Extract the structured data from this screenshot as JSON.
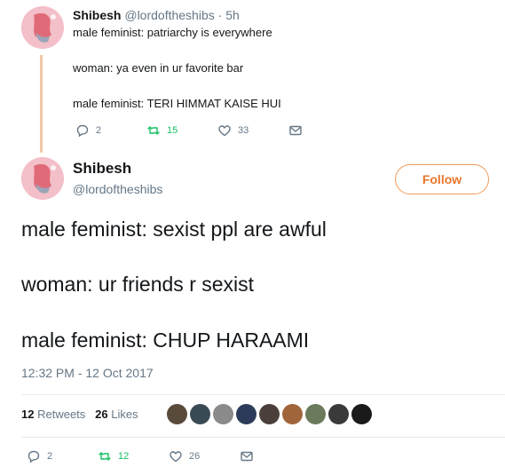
{
  "reply_tweet": {
    "name": "Shibesh",
    "handle": "@lordoftheshibs",
    "separator": "·",
    "time": "5h",
    "lines": [
      "male feminist: patriarchy is everywhere",
      "woman: ya even in ur favorite bar",
      "male feminist: TERI HIMMAT KAISE HUI"
    ],
    "replies": "2",
    "retweets": "15",
    "likes": "33"
  },
  "main_tweet": {
    "name": "Shibesh",
    "handle": "@lordoftheshibs",
    "follow_label": "Follow",
    "lines": [
      "male feminist: sexist ppl are awful",
      "woman: ur friends r sexist",
      "male feminist: CHUP HARAAMI"
    ],
    "timestamp": "12:32 PM - 12 Oct 2017",
    "retweet_count": "12",
    "retweets_label": "Retweets",
    "like_count": "26",
    "likes_label": "Likes",
    "replies": "2",
    "retweets": "12",
    "likes": "26"
  },
  "colors": {
    "accent": "#e8762c",
    "retweet_green": "#17bf63",
    "muted": "#657786",
    "thread_line": "#f2c8a8",
    "avatar_bg": "#f3bfc8"
  },
  "liker_avatar_colors": [
    "#5a4a3a",
    "#3a4a55",
    "#8a8a8a",
    "#2d3b5a",
    "#4a3f3a",
    "#a0653a",
    "#6a7a5a",
    "#3a3a3a",
    "#1a1a1a"
  ]
}
